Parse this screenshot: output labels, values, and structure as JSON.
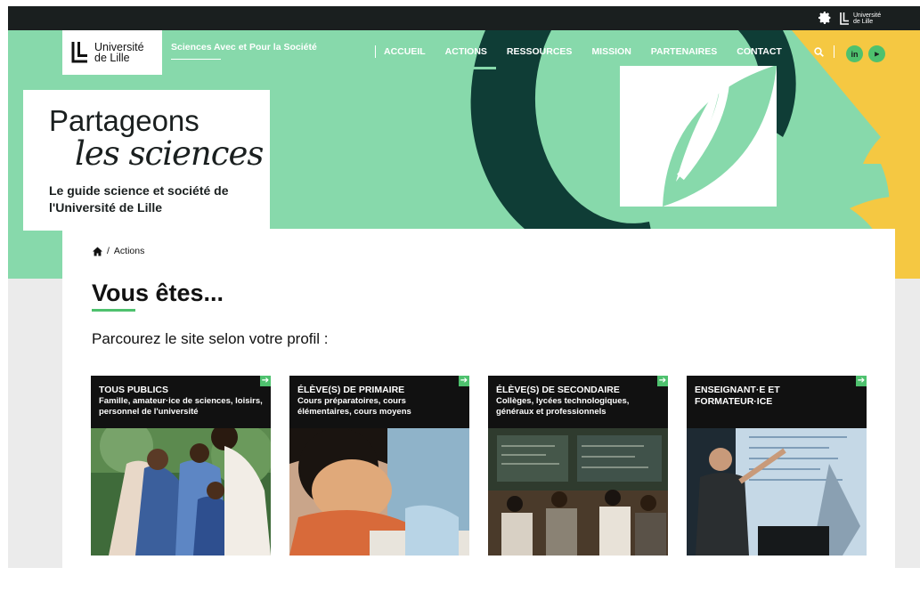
{
  "topbar": {
    "settings_icon": "gear-icon",
    "logo_line1": "Université",
    "logo_line2": "de Lille"
  },
  "header": {
    "logo_line1": "Université",
    "logo_line2": "de Lille",
    "tagline": "Sciences Avec et Pour la Société",
    "nav": [
      {
        "label": "ACCUEIL",
        "active": false
      },
      {
        "label": "ACTIONS",
        "active": true
      },
      {
        "label": "RESSOURCES",
        "active": false
      },
      {
        "label": "MISSION",
        "active": false
      },
      {
        "label": "PARTENAIRES",
        "active": false
      },
      {
        "label": "CONTACT",
        "active": false
      }
    ],
    "search_icon": "search-icon",
    "social": [
      {
        "name": "linkedin-icon",
        "glyph": "in"
      },
      {
        "name": "podcast-icon",
        "glyph": "⫸"
      }
    ]
  },
  "hero": {
    "title_line1": "Partageons",
    "title_line2": "les sciences",
    "subtitle": "Le guide science et société de l'Université de Lille"
  },
  "breadcrumb": {
    "home_icon": "home-icon",
    "separator": "/",
    "current": "Actions"
  },
  "main": {
    "title": "Vous êtes...",
    "intro": "Parcourez le site selon votre profil :",
    "profiles": [
      {
        "title": "TOUS PUBLICS",
        "desc": "Famille, amateur·ice de sciences, loisirs, personnel de l'université"
      },
      {
        "title": "ÉLÈVE(S) DE PRIMAIRE",
        "desc": "Cours préparatoires, cours élémentaires, cours moyens"
      },
      {
        "title": "ÉLÈVE(S) DE SECONDAIRE",
        "desc": "Collèges, lycées technologiques, généraux et professionnels"
      },
      {
        "title": "ENSEIGNANT·E ET FORMATEUR·ICE",
        "desc": ""
      }
    ]
  },
  "colors": {
    "accent_green": "#87d9ab",
    "bright_green": "#4ec16e",
    "dark": "#1a1f1f",
    "yellow": "#f5c842",
    "deep_teal": "#0f3d36"
  }
}
